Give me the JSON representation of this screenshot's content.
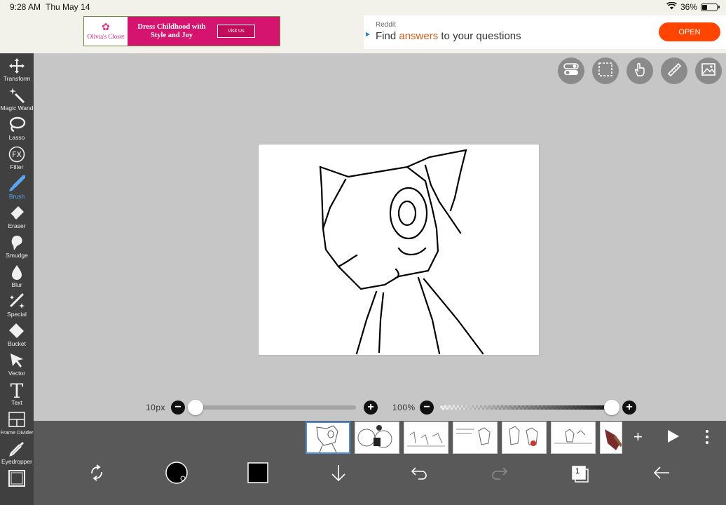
{
  "status": {
    "time": "9:28 AM",
    "date": "Thu May 14",
    "battery": "36%",
    "battery_level": 0.36
  },
  "ad_left": {
    "brand": "Olivia's Closet",
    "text": "Dress Childhood with Style and Joy",
    "button": "Visit Us"
  },
  "ad_right": {
    "source": "Reddit",
    "headline_pre": "Find ",
    "headline_hl": "answers",
    "headline_post": " to your questions",
    "button": "OPEN"
  },
  "tools": [
    {
      "label": "Transform",
      "icon": "move-arrows-icon"
    },
    {
      "label": "Magic Wand",
      "icon": "magic-wand-icon"
    },
    {
      "label": "Lasso",
      "icon": "lasso-icon"
    },
    {
      "label": "Filter",
      "icon": "fx-icon"
    },
    {
      "label": "Brush",
      "icon": "brush-icon"
    },
    {
      "label": "Eraser",
      "icon": "eraser-icon"
    },
    {
      "label": "Smudge",
      "icon": "smudge-icon"
    },
    {
      "label": "Blur",
      "icon": "droplet-icon"
    },
    {
      "label": "Special",
      "icon": "sparkle-pen-icon"
    },
    {
      "label": "Bucket",
      "icon": "bucket-icon"
    },
    {
      "label": "Vector",
      "icon": "cursor-arrow-icon"
    },
    {
      "label": "Text",
      "icon": "text-t-icon"
    },
    {
      "label": "Frame Divider",
      "icon": "frame-divider-icon"
    },
    {
      "label": "Eyedropper",
      "icon": "eyedropper-icon"
    }
  ],
  "active_tool": "Brush",
  "brush": {
    "size_label": "10px",
    "size_value": 10,
    "opacity_label": "100%",
    "opacity_value": 100
  },
  "colors": {
    "accent": "#5aa6f0",
    "toolbar_bg": "#404040",
    "bottom_bg": "#595959",
    "workspace_bg": "#c6c6c6",
    "reddit_orange": "#ff4500"
  },
  "frames": {
    "count_visible": 7,
    "selected_index": 0
  },
  "layers_count": "1"
}
